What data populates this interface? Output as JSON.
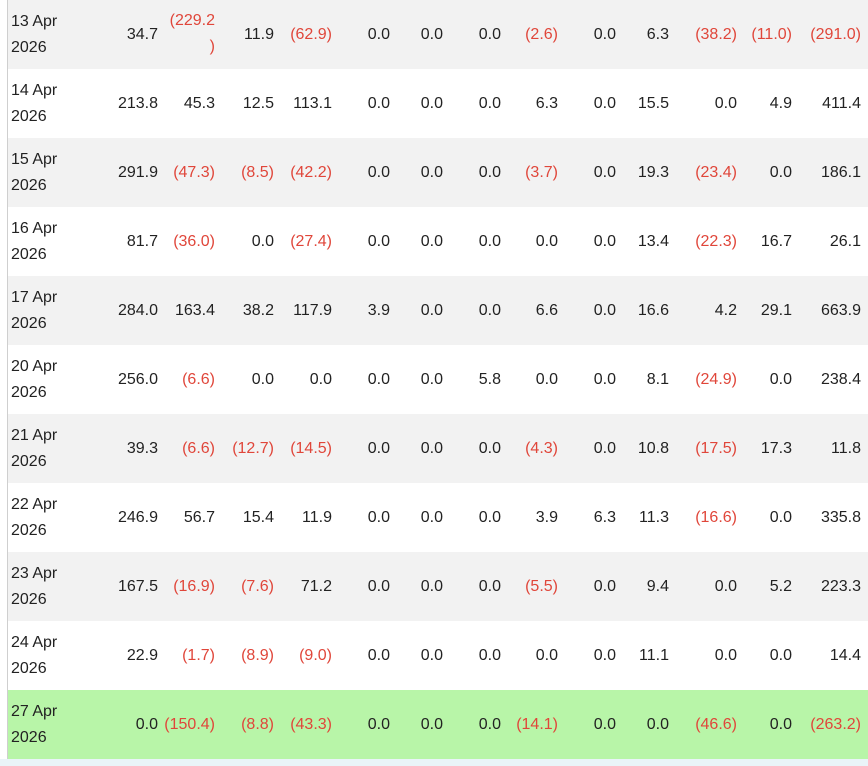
{
  "rows": [
    {
      "date": "13 Apr\n2026",
      "values": [
        "34.7",
        "(229.2\n)",
        "11.9",
        "(62.9)",
        "0.0",
        "0.0",
        "0.0",
        "(2.6)",
        "0.0",
        "6.3",
        "(38.2)",
        "(11.0)",
        "(291.0)"
      ],
      "neg": [
        false,
        true,
        false,
        true,
        false,
        false,
        false,
        true,
        false,
        false,
        true,
        true,
        true
      ]
    },
    {
      "date": "14 Apr\n2026",
      "values": [
        "213.8",
        "45.3",
        "12.5",
        "113.1",
        "0.0",
        "0.0",
        "0.0",
        "6.3",
        "0.0",
        "15.5",
        "0.0",
        "4.9",
        "411.4"
      ],
      "neg": [
        false,
        false,
        false,
        false,
        false,
        false,
        false,
        false,
        false,
        false,
        false,
        false,
        false
      ]
    },
    {
      "date": "15 Apr\n2026",
      "values": [
        "291.9",
        "(47.3)",
        "(8.5)",
        "(42.2)",
        "0.0",
        "0.0",
        "0.0",
        "(3.7)",
        "0.0",
        "19.3",
        "(23.4)",
        "0.0",
        "186.1"
      ],
      "neg": [
        false,
        true,
        true,
        true,
        false,
        false,
        false,
        true,
        false,
        false,
        true,
        false,
        false
      ]
    },
    {
      "date": "16 Apr\n2026",
      "values": [
        "81.7",
        "(36.0)",
        "0.0",
        "(27.4)",
        "0.0",
        "0.0",
        "0.0",
        "0.0",
        "0.0",
        "13.4",
        "(22.3)",
        "16.7",
        "26.1"
      ],
      "neg": [
        false,
        true,
        false,
        true,
        false,
        false,
        false,
        false,
        false,
        false,
        true,
        false,
        false
      ]
    },
    {
      "date": "17 Apr\n2026",
      "values": [
        "284.0",
        "163.4",
        "38.2",
        "117.9",
        "3.9",
        "0.0",
        "0.0",
        "6.6",
        "0.0",
        "16.6",
        "4.2",
        "29.1",
        "663.9"
      ],
      "neg": [
        false,
        false,
        false,
        false,
        false,
        false,
        false,
        false,
        false,
        false,
        false,
        false,
        false
      ]
    },
    {
      "date": "20 Apr\n2026",
      "values": [
        "256.0",
        "(6.6)",
        "0.0",
        "0.0",
        "0.0",
        "0.0",
        "5.8",
        "0.0",
        "0.0",
        "8.1",
        "(24.9)",
        "0.0",
        "238.4"
      ],
      "neg": [
        false,
        true,
        false,
        false,
        false,
        false,
        false,
        false,
        false,
        false,
        true,
        false,
        false
      ]
    },
    {
      "date": "21 Apr\n2026",
      "values": [
        "39.3",
        "(6.6)",
        "(12.7)",
        "(14.5)",
        "0.0",
        "0.0",
        "0.0",
        "(4.3)",
        "0.0",
        "10.8",
        "(17.5)",
        "17.3",
        "11.8"
      ],
      "neg": [
        false,
        true,
        true,
        true,
        false,
        false,
        false,
        true,
        false,
        false,
        true,
        false,
        false
      ]
    },
    {
      "date": "22 Apr\n2026",
      "values": [
        "246.9",
        "56.7",
        "15.4",
        "11.9",
        "0.0",
        "0.0",
        "0.0",
        "3.9",
        "6.3",
        "11.3",
        "(16.6)",
        "0.0",
        "335.8"
      ],
      "neg": [
        false,
        false,
        false,
        false,
        false,
        false,
        false,
        false,
        false,
        false,
        true,
        false,
        false
      ]
    },
    {
      "date": "23 Apr\n2026",
      "values": [
        "167.5",
        "(16.9)",
        "(7.6)",
        "71.2",
        "0.0",
        "0.0",
        "0.0",
        "(5.5)",
        "0.0",
        "9.4",
        "0.0",
        "5.2",
        "223.3"
      ],
      "neg": [
        false,
        true,
        true,
        false,
        false,
        false,
        false,
        true,
        false,
        false,
        false,
        false,
        false
      ]
    },
    {
      "date": "24 Apr\n2026",
      "values": [
        "22.9",
        "(1.7)",
        "(8.9)",
        "(9.0)",
        "0.0",
        "0.0",
        "0.0",
        "0.0",
        "0.0",
        "11.1",
        "0.0",
        "0.0",
        "14.4"
      ],
      "neg": [
        false,
        true,
        true,
        true,
        false,
        false,
        false,
        false,
        false,
        false,
        false,
        false,
        false
      ]
    },
    {
      "date": "27 Apr\n2026",
      "values": [
        "0.0",
        "(150.4)",
        "(8.8)",
        "(43.3)",
        "0.0",
        "0.0",
        "0.0",
        "(14.1)",
        "0.0",
        "0.0",
        "(46.6)",
        "0.0",
        "(263.2)"
      ],
      "neg": [
        false,
        true,
        true,
        true,
        false,
        false,
        false,
        true,
        false,
        false,
        true,
        false,
        true
      ],
      "highlight": true
    }
  ],
  "colors": {
    "negative": "#e0463a",
    "highlight": "#b8f5a8",
    "stripe": "#f2f2f2"
  }
}
